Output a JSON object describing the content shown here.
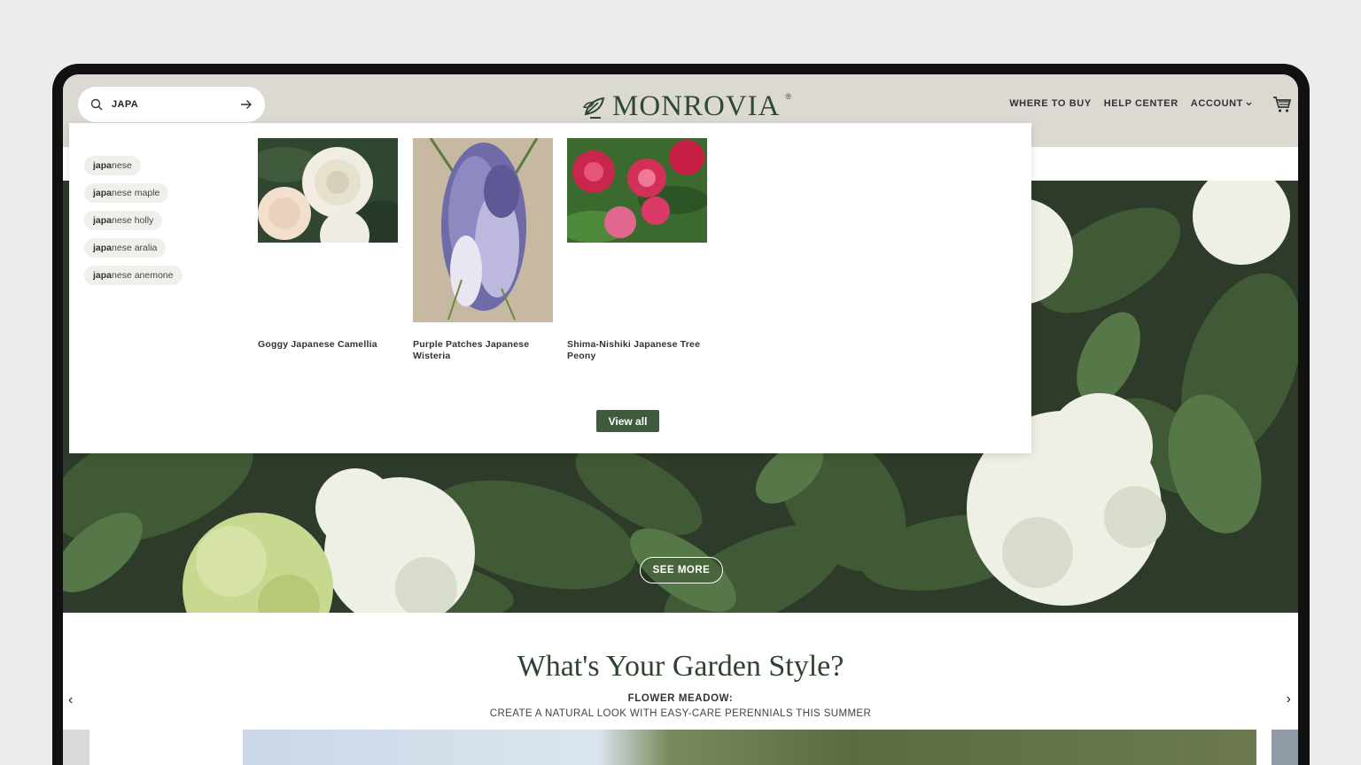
{
  "header": {
    "logo_text": "MONROVIA",
    "logo_reg": "®",
    "nav": {
      "where_to_buy": "WHERE TO BUY",
      "help_center": "HELP CENTER",
      "account": "ACCOUNT"
    }
  },
  "search": {
    "value": "JAPA",
    "suggestions": [
      {
        "match": "japa",
        "rest": "nese"
      },
      {
        "match": "japa",
        "rest": "nese maple"
      },
      {
        "match": "japa",
        "rest": "nese holly"
      },
      {
        "match": "japa",
        "rest": "nese aralia"
      },
      {
        "match": "japa",
        "rest": "nese anemone"
      }
    ],
    "products": [
      {
        "name": "Goggy Japanese Camellia"
      },
      {
        "name": "Purple Patches Japanese Wisteria"
      },
      {
        "name": "Shima-Nishiki Japanese Tree Peony"
      }
    ],
    "view_all_label": "View all"
  },
  "hero": {
    "see_more_label": "SEE MORE"
  },
  "section": {
    "title": "What's Your Garden Style?",
    "subtitle": "FLOWER MEADOW:",
    "description": "CREATE A NATURAL LOOK WITH EASY-CARE PERENNIALS THIS SUMMER"
  },
  "colors": {
    "brand_green": "#2f4a34",
    "button_green": "#3f5b3d",
    "header_bg": "#dcd9d3"
  }
}
